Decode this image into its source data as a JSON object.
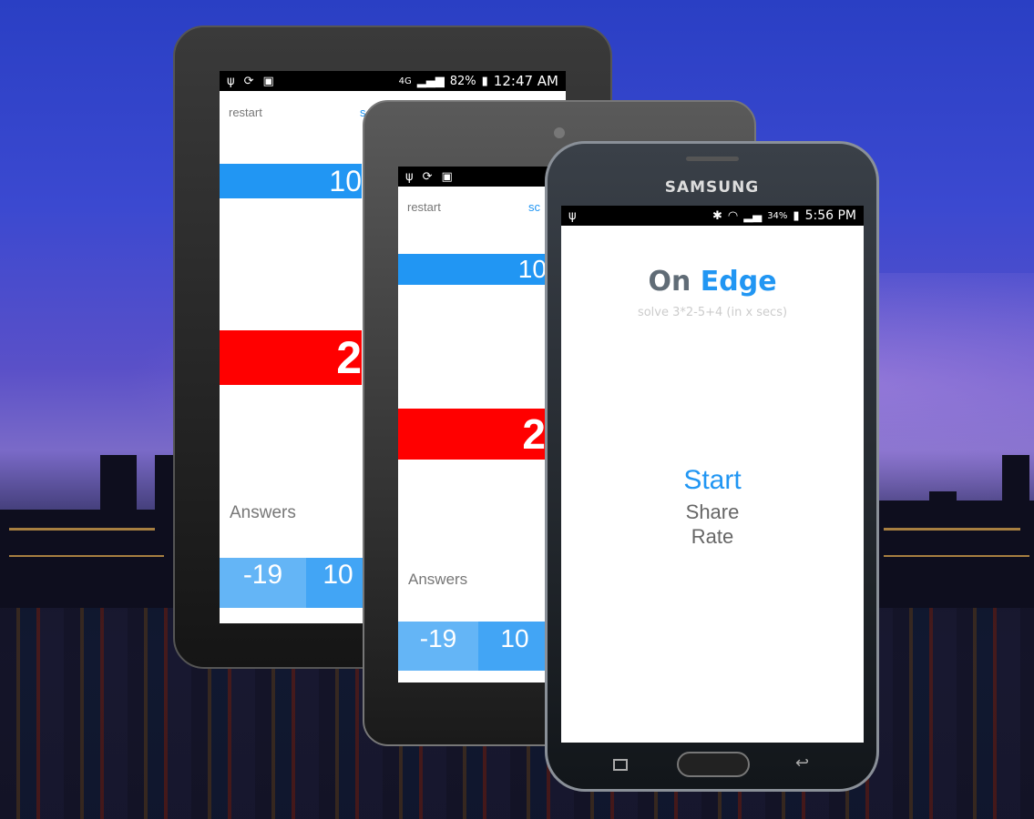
{
  "tablet_large": {
    "status": {
      "icons": [
        "usb-icon",
        "sync-icon",
        "store-icon"
      ],
      "network": "4G",
      "battery": "82%",
      "time": "12:47 AM"
    },
    "restart": "restart",
    "score_partial": "s",
    "blue_bar": "10",
    "red_bar": "2",
    "answers_label": "Answers",
    "answers": [
      "-19",
      "10"
    ]
  },
  "tablet_medium": {
    "status": {
      "icons": [
        "usb-icon",
        "sync-icon",
        "store-icon"
      ]
    },
    "restart": "restart",
    "score_partial": "sc",
    "blue_bar": "10 -",
    "red_bar": "2",
    "answers_label": "Answers",
    "answers": [
      "-19",
      "10"
    ]
  },
  "phone": {
    "brand": "SAMSUNG",
    "status": {
      "battery": "34%",
      "time": "5:56 PM"
    },
    "title_part1": "On",
    "title_part2": "Edge",
    "subtitle": "solve 3*2-5+4 (in x secs)",
    "menu": {
      "start": "Start",
      "share": "Share",
      "rate": "Rate"
    }
  },
  "colors": {
    "blue": "#2196f3",
    "red": "#ff0000",
    "tile_light": "#64b5f6",
    "tile": "#42a5f5",
    "title_gray": "#606c76"
  }
}
